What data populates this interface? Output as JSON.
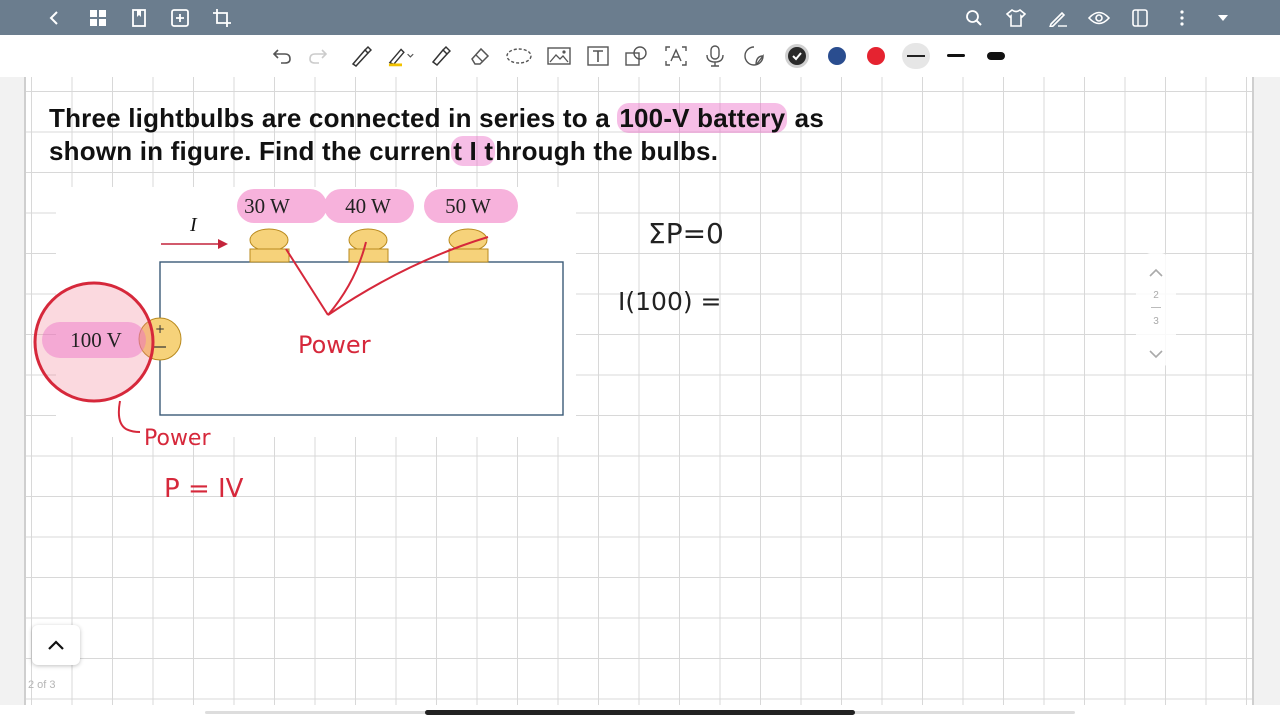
{
  "question": {
    "part1": "Three lightbulbs are connected in series to a ",
    "highlight1": "100-V battery",
    "part2": " as",
    "part3": "shown in figure. Find the curren",
    "highlight2": "t I t",
    "part4": "hrough the bulbs."
  },
  "figure": {
    "bulb_labels": [
      "30 W",
      "40 W",
      "50 W"
    ],
    "battery_label": "100 V",
    "current_label": "I"
  },
  "handwriting": {
    "power_center": "Power",
    "power_left": "Power",
    "formula": "P = IV",
    "sum": "ΣP=0",
    "equation": "I(100) ="
  },
  "side_nav": {
    "current": "2",
    "total": "3"
  },
  "page_count": "2 of 3",
  "colors": {
    "topbar": "#6b7d8e",
    "ink_red": "#d6283b",
    "highlight_pink": "#ec6ec8",
    "ink_dark": "#222222",
    "pen_blue": "#2a4d8f"
  },
  "toolbar": {
    "tools": [
      "undo-icon",
      "redo-icon",
      "pen-icon",
      "highlighter-icon",
      "marker-icon",
      "eraser-icon",
      "lasso-icon",
      "image-icon",
      "text-icon",
      "shapes-icon",
      "ocr-icon",
      "mic-icon",
      "sticker-icon"
    ],
    "colors": [
      "#2b2b2b",
      "#2a4d8f",
      "#e52330"
    ]
  }
}
